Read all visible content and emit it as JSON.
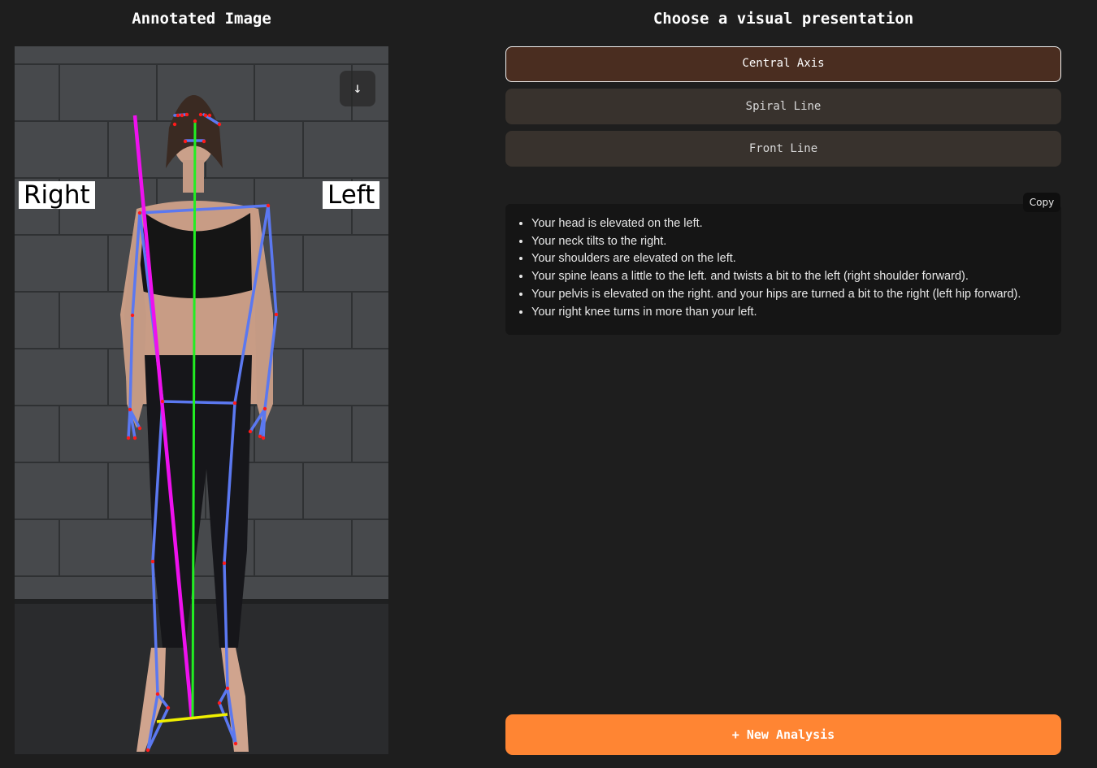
{
  "left_panel": {
    "title": "Annotated Image",
    "download_icon": "↓",
    "labels": {
      "right": "Right",
      "left": "Left"
    }
  },
  "right_panel": {
    "title": "Choose a visual presentation",
    "options": [
      {
        "label": "Central Axis",
        "selected": true
      },
      {
        "label": "Spiral Line",
        "selected": false
      },
      {
        "label": "Front Line",
        "selected": false
      }
    ],
    "copy_label": "Copy",
    "feedback": [
      "Your head is elevated on the left.",
      "Your neck tilts to the right.",
      "Your shoulders are elevated on the left.",
      "Your spine leans a little to the left. and twists a bit to the left (right shoulder forward).",
      "Your pelvis is elevated on the right. and your hips are turned a bit to the right (left hip forward).",
      "Your right knee turns in more than your left."
    ],
    "new_analysis_label": "+ New Analysis"
  },
  "colors": {
    "accent": "#ff8533",
    "selected_option": "#4a2d20",
    "option": "#38322d",
    "skeleton": "#5b78f0",
    "axis_green": "#22ee22",
    "axis_magenta": "#ee11ee",
    "base_yellow": "#f0f000"
  }
}
